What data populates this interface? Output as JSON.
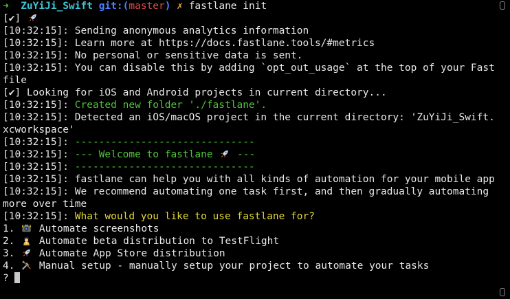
{
  "prompt": {
    "arrow": "➜",
    "dir": "ZuYiJi_Swift",
    "git_label": "git:(",
    "branch": "master",
    "git_close": ")",
    "x": "✗",
    "command": "fastlane init"
  },
  "lines": {
    "l1": "[✔] ",
    "l2": "[10:32:15]: Sending anonymous analytics information",
    "l3": "[10:32:15]: Learn more at https://docs.fastlane.tools/#metrics",
    "l4": "[10:32:15]: No personal or sensitive data is sent.",
    "l5": "[10:32:15]: You can disable this by adding `opt_out_usage` at the top of your Fastfile",
    "l6": "[✔] Looking for iOS and Android projects in current directory...",
    "l7_ts": "[10:32:15]: ",
    "l7_msg": "Created new folder './fastlane'.",
    "l8": "[10:32:15]: Detected an iOS/macOS project in the current directory: 'ZuYiJi_Swift.xcworkspace'",
    "l9_ts": "[10:32:15]: ",
    "l9_msg": "------------------------------",
    "l10_ts": "[10:32:15]: ",
    "l10_msg_a": "--- Welcome to fastlane ",
    "l10_msg_b": " ---",
    "l11_ts": "[10:32:15]: ",
    "l11_msg": "------------------------------",
    "l12": "[10:32:15]: fastlane can help you with all kinds of automation for your mobile app",
    "l13": "[10:32:15]: We recommend automating one task first, and then gradually automating more over time",
    "l14_ts": "[10:32:15]: ",
    "l14_msg": "What would you like to use fastlane for?",
    "opt1_num": "1. ",
    "opt1": " Automate screenshots",
    "opt2_num": "2. ",
    "opt2": " Automate beta distribution to TestFlight",
    "opt3_num": "3. ",
    "opt3": " Automate App Store distribution",
    "opt4_num": "4. ",
    "opt4": " Manual setup - manually setup your project to automate your tasks",
    "input_prompt": "?"
  },
  "icons": {
    "rocket": "rocket-icon",
    "camera": "camera-icon",
    "pilot": "pilot-icon",
    "tools": "tools-icon"
  }
}
